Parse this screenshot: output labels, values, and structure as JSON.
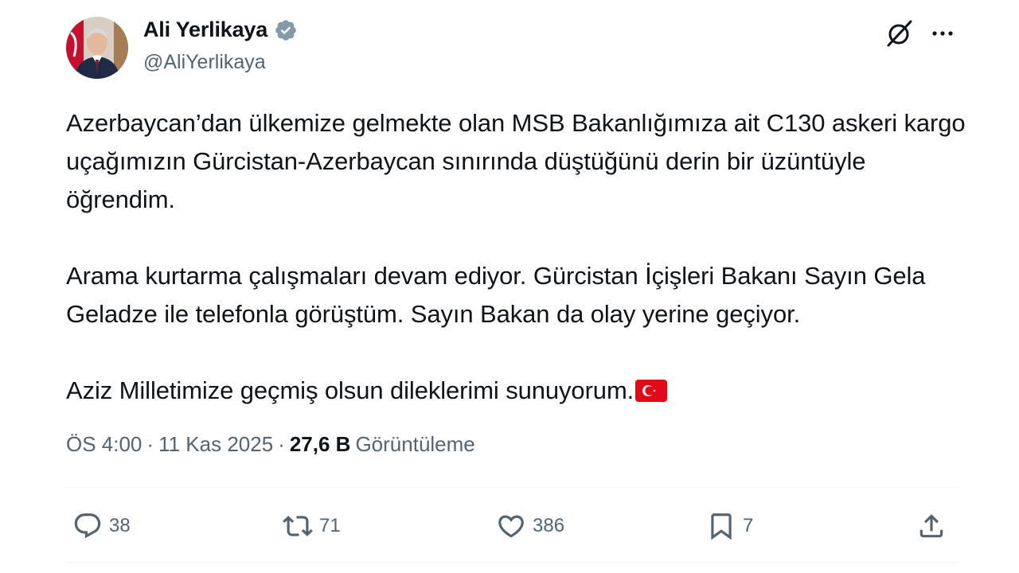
{
  "author": {
    "name": "Ali Yerlikaya",
    "handle": "@AliYerlikaya",
    "verified": true
  },
  "tweet": {
    "paragraphs": [
      "Azerbaycan’dan ülkemize gelmekte olan MSB Bakanlığımıza ait C130 askeri kargo uçağımızın Gürcistan-Azerbaycan sınırında düştüğünü derin bir üzüntüyle öğrendim.",
      "Arama kurtarma çalışmaları devam ediyor. Gürcistan İçişleri Bakanı Sayın Gela Geladze ile telefonla görüştüm. Sayın Bakan da olay yerine geçiyor.",
      "Aziz Milletimize geçmiş olsun dileklerimi sunuyorum."
    ],
    "emoji": "turkey-flag-emoji"
  },
  "meta": {
    "time": "ÖS 4:00",
    "sep1": "·",
    "date": "11 Kas 2025",
    "sep2": "·",
    "views": "27,6 B",
    "views_label": "Görüntüleme"
  },
  "actions": {
    "replies": "38",
    "reposts": "71",
    "likes": "386",
    "bookmarks": "7"
  },
  "icons": [
    "verified-badge-icon",
    "grok-icon",
    "more-icon",
    "reply-icon",
    "repost-icon",
    "like-icon",
    "bookmark-icon",
    "share-icon"
  ],
  "colors": {
    "verified": "#829aab",
    "text": "#0f1419",
    "secondary": "#536471",
    "flag_red": "#e30a17"
  }
}
